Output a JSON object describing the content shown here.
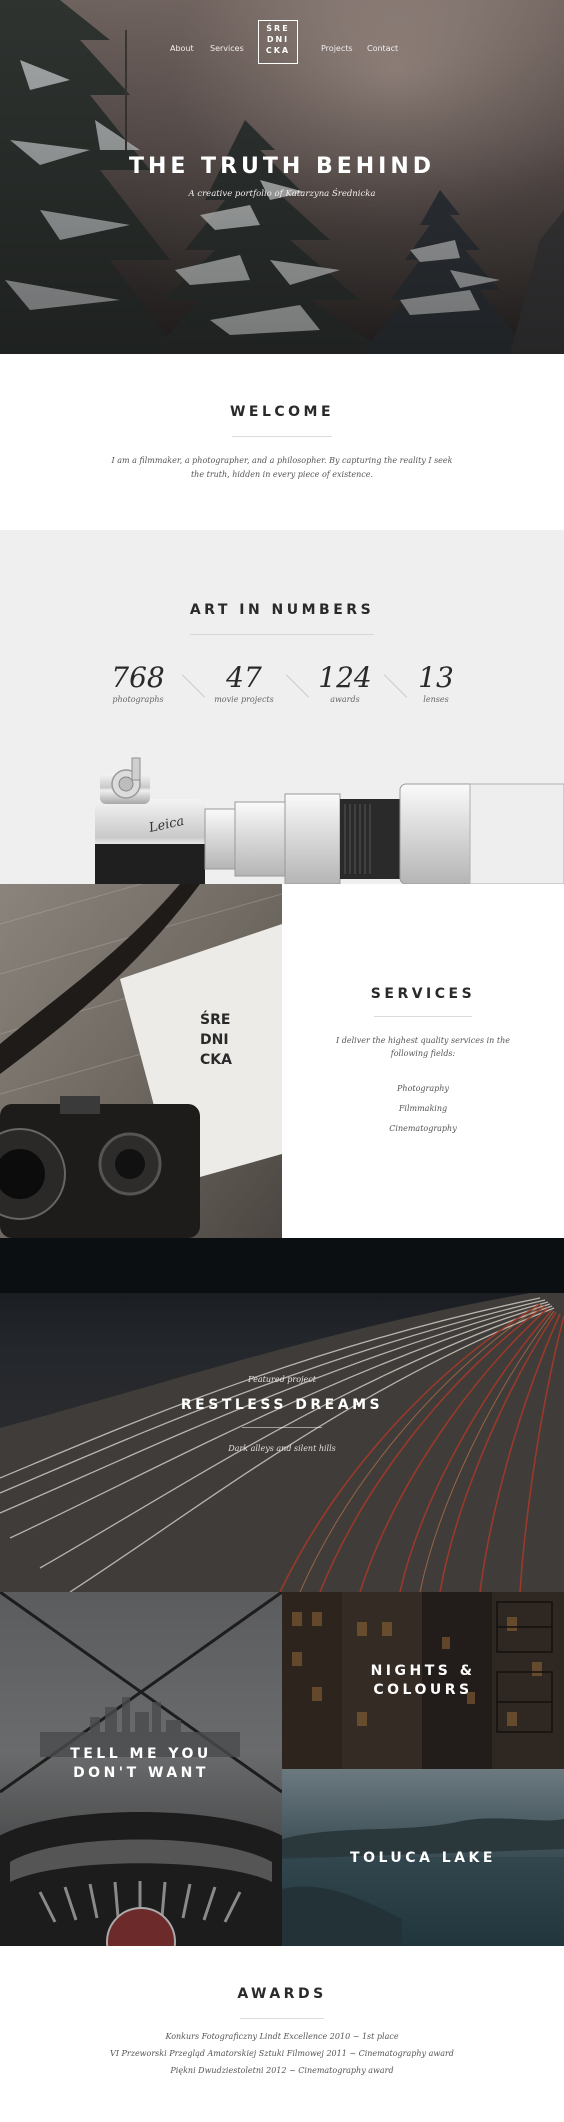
{
  "nav": {
    "about": "About",
    "services": "Services",
    "projects": "Projects",
    "contact": "Contact",
    "logo_lines": [
      "ŚRE",
      "DNI",
      "CKA"
    ]
  },
  "hero": {
    "title": "THE TRUTH BEHIND",
    "subtitle": "A creative portfolio of Katarzyna Średnicka"
  },
  "welcome": {
    "title": "WELCOME",
    "text_line1": "I am a filmmaker, a photographer, and a philosopher. By capturing the reality I seek",
    "text_line2": "the truth, hidden in every piece of existence."
  },
  "numbers": {
    "title": "ART IN NUMBERS",
    "stats": [
      {
        "value": "768",
        "label": "photographs"
      },
      {
        "value": "47",
        "label": "movie projects"
      },
      {
        "value": "124",
        "label": "awards"
      },
      {
        "value": "13",
        "label": "lenses"
      }
    ]
  },
  "services": {
    "title": "SERVICES",
    "lead_line1": "I deliver the highest quality services in the",
    "lead_line2": "following fields:",
    "items": [
      "Photography",
      "Filmmaking",
      "Cinematography"
    ],
    "card_letters": [
      "ŚRE",
      "DNI",
      "CKA"
    ]
  },
  "featured": {
    "label": "Featured project",
    "title": "RESTLESS DREAMS",
    "description": "Dark alleys and silent hills"
  },
  "projects": {
    "tell_me_line1": "TELL ME YOU",
    "tell_me_line2": "DON'T WANT",
    "nights_line1": "NIGHTS &",
    "nights_line2": "COLOURS",
    "toluca": "TOLUCA LAKE"
  },
  "awards": {
    "title": "AWARDS",
    "items": [
      "Konkurs Fotograficzny Lindt Excellence 2010 ~ 1st place",
      "VI Przeworski Przegląd Amatorskiej Sztuki Filmowej 2011 ~ Cinematography award",
      "Piękni Dwudziestoletni 2012 ~ Cinematography award"
    ]
  }
}
